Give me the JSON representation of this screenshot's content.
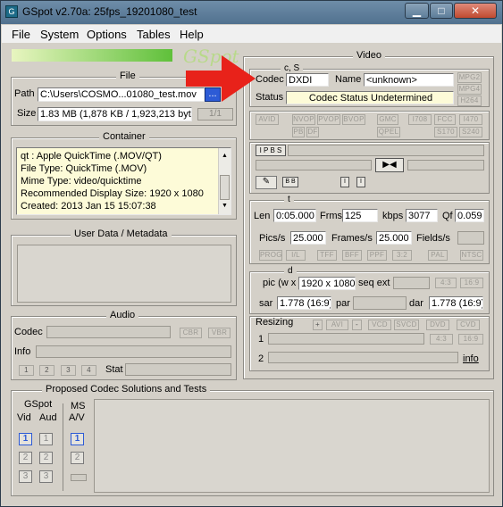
{
  "window": {
    "title": "GSpot v2.70a: 25fps_19201080_test",
    "icon": "app-icon"
  },
  "menu": [
    "File",
    "System",
    "Options",
    "Tables",
    "Help"
  ],
  "logo": "GSpot",
  "file": {
    "title": "File",
    "path_label": "Path",
    "path_value": "C:\\Users\\COSMO...01080_test.mov",
    "browse_label": "...",
    "size_label": "Size",
    "size_value": "1.83 MB (1,878 KB / 1,923,213 byte",
    "page": "1/1"
  },
  "container": {
    "title": "Container",
    "lines": [
      "qt  : Apple QuickTime (.MOV/QT)",
      "File Type: QuickTime (.MOV)",
      "Mime Type: video/quicktime",
      "Recommended Display Size: 1920 x 1080",
      "Created:    2013 Jan 15   15:07:38"
    ]
  },
  "userdata": {
    "title": "User Data / Metadata"
  },
  "audio": {
    "title": "Audio",
    "codec_label": "Codec",
    "info_label": "Info",
    "cbr": "CBR",
    "vbr": "VBR",
    "streams": [
      "1",
      "2",
      "3",
      "4"
    ],
    "stat_label": "Stat"
  },
  "video": {
    "title": "Video",
    "cs_label": "c, S",
    "codec_label": "Codec",
    "codec_value": "DXDI",
    "name_label": "Name",
    "name_value": "<unknown>",
    "status_label": "Status",
    "status_value": "Codec Status Undetermined",
    "side_tags": [
      "MPG2",
      "MPG4",
      "H264"
    ],
    "flags_row1": [
      "AVID",
      "NVOP",
      "PVOP",
      "BVOP",
      "GMC",
      "I708",
      "FCC",
      "I470"
    ],
    "flags_row2": [
      "PB",
      "DF",
      "QPEL",
      "S170",
      "S240"
    ],
    "ipbs": "I P B S",
    "bb": "B B",
    "i1": "I",
    "i2": "I",
    "t_label": "t",
    "len_label": "Len",
    "len_value": "0:05.000",
    "frms_label": "Frms",
    "frms_value": "125",
    "kbps_label": "kbps",
    "kbps_value": "3077",
    "qf_label": "Qf",
    "qf_value": "0.059",
    "pics_label": "Pics/s",
    "pics_value": "25.000",
    "frames_label": "Frames/s",
    "frames_value": "25.000",
    "fields_label": "Fields/s",
    "scan_tags": [
      "PROG",
      "I/L",
      "TFF",
      "BFF",
      "PPF",
      "3:2",
      "PAL",
      "NTSC"
    ],
    "d_label": "d",
    "pic_label": "pic (w x",
    "pic_value": "1920 x 1080",
    "seqext_label": "seq ext",
    "ar_tags": [
      "4:3",
      "16:9"
    ],
    "sar_label": "sar",
    "sar_value": "1.778 (16:9)",
    "par_label": "par",
    "dar_label": "dar",
    "dar_value": "1.778 (16:9)",
    "resizing_label": "Resizing",
    "resize_tags": [
      "+",
      "AVI",
      "-",
      "VCD",
      "SVCD",
      "DVD",
      "CVD"
    ],
    "row1_label": "1",
    "row2_label": "2",
    "ar2_tags": [
      "4:3",
      "16:9"
    ],
    "info_link": "info"
  },
  "proposed": {
    "title": "Proposed Codec Solutions and Tests",
    "gspot_label": "GSpot",
    "vid_label": "Vid",
    "aud_label": "Aud",
    "ms_label": "MS",
    "av_label": "A/V",
    "vid": [
      "1",
      "2",
      "3"
    ],
    "aud": [
      "1",
      "2",
      "3"
    ],
    "ms": [
      "1",
      "2"
    ]
  }
}
